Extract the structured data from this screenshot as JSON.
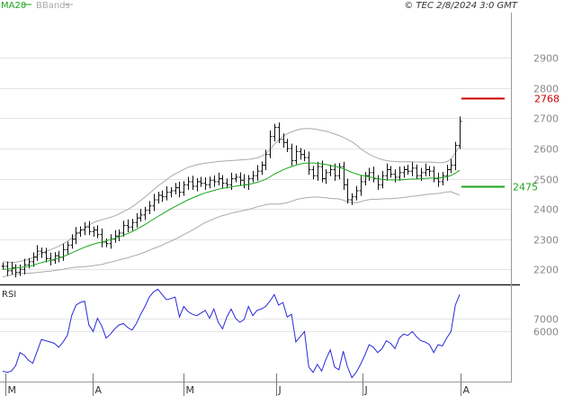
{
  "header": {
    "ma_label": "MA20",
    "bbands_label": "BBands",
    "source_label": "© TEC 2/8/2024 3:0 GMT"
  },
  "colors": {
    "background": "#ffffff",
    "grid": "#e4e4e4",
    "price_bar": "#111111",
    "ma": "#1aa51a",
    "bbands": "#aaaaaa",
    "rsi": "#2a2ad8",
    "resistance": "#cc0000",
    "support": "#1aa51a"
  },
  "chart_data": [
    {
      "type": "ohlc",
      "title": "",
      "y_ticks": [
        2200,
        2300,
        2400,
        2500,
        2600,
        2700,
        2800,
        2900
      ],
      "ylim": [
        2150,
        3050
      ],
      "x_month_labels": [
        "M",
        "A",
        "M",
        "J",
        "J",
        "A"
      ],
      "grid": true,
      "levels": [
        {
          "label": "2768",
          "value": 2768,
          "color": "#cc0000"
        },
        {
          "label": "2475",
          "value": 2475,
          "color": "#1aa51a"
        }
      ],
      "closes": [
        2210,
        2195,
        2205,
        2190,
        2200,
        2215,
        2225,
        2240,
        2260,
        2255,
        2235,
        2230,
        2245,
        2240,
        2265,
        2280,
        2300,
        2320,
        2330,
        2340,
        2325,
        2330,
        2315,
        2290,
        2285,
        2300,
        2310,
        2320,
        2345,
        2340,
        2355,
        2370,
        2380,
        2395,
        2410,
        2430,
        2445,
        2440,
        2455,
        2460,
        2470,
        2455,
        2480,
        2490,
        2475,
        2490,
        2485,
        2480,
        2495,
        2490,
        2500,
        2485,
        2480,
        2500,
        2505,
        2495,
        2480,
        2500,
        2510,
        2525,
        2545,
        2580,
        2640,
        2670,
        2630,
        2620,
        2600,
        2560,
        2590,
        2580,
        2570,
        2530,
        2510,
        2540,
        2500,
        2520,
        2530,
        2510,
        2540,
        2480,
        2430,
        2440,
        2460,
        2490,
        2510,
        2520,
        2500,
        2480,
        2510,
        2530,
        2515,
        2505,
        2520,
        2530,
        2525,
        2535,
        2510,
        2520,
        2530,
        2525,
        2500,
        2490,
        2510,
        2530,
        2545,
        2610,
        2690
      ],
      "ma20": [
        2200,
        2201,
        2202,
        2204,
        2206,
        2208,
        2210,
        2213,
        2218,
        2222,
        2226,
        2229,
        2233,
        2237,
        2242,
        2248,
        2254,
        2261,
        2267,
        2273,
        2278,
        2283,
        2287,
        2290,
        2294,
        2298,
        2302,
        2307,
        2313,
        2318,
        2325,
        2332,
        2340,
        2348,
        2357,
        2366,
        2375,
        2383,
        2392,
        2400,
        2408,
        2415,
        2423,
        2430,
        2436,
        2442,
        2448,
        2453,
        2457,
        2461,
        2465,
        2468,
        2470,
        2473,
        2475,
        2477,
        2479,
        2481,
        2484,
        2488,
        2492,
        2498,
        2506,
        2515,
        2522,
        2529,
        2535,
        2540,
        2545,
        2549,
        2551,
        2552,
        2552,
        2551,
        2549,
        2547,
        2544,
        2541,
        2538,
        2533,
        2527,
        2521,
        2516,
        2512,
        2509,
        2506,
        2503,
        2500,
        2498,
        2497,
        2496,
        2496,
        2496,
        2497,
        2498,
        2499,
        2499,
        2500,
        2501,
        2502,
        2502,
        2502,
        2503,
        2506,
        2511,
        2518,
        2528
      ],
      "bb_upper": [
        2225,
        2224,
        2223,
        2224,
        2226,
        2229,
        2233,
        2238,
        2246,
        2253,
        2259,
        2264,
        2270,
        2276,
        2284,
        2293,
        2303,
        2315,
        2326,
        2337,
        2346,
        2354,
        2360,
        2364,
        2368,
        2372,
        2377,
        2383,
        2391,
        2398,
        2407,
        2417,
        2428,
        2439,
        2451,
        2463,
        2476,
        2486,
        2497,
        2507,
        2516,
        2523,
        2531,
        2538,
        2542,
        2546,
        2549,
        2551,
        2553,
        2555,
        2557,
        2558,
        2559,
        2560,
        2561,
        2562,
        2563,
        2564,
        2566,
        2569,
        2574,
        2582,
        2596,
        2614,
        2628,
        2640,
        2649,
        2655,
        2660,
        2664,
        2666,
        2666,
        2665,
        2663,
        2660,
        2657,
        2653,
        2648,
        2643,
        2637,
        2630,
        2622,
        2612,
        2600,
        2590,
        2581,
        2574,
        2568,
        2563,
        2560,
        2558,
        2557,
        2556,
        2556,
        2556,
        2556,
        2555,
        2555,
        2555,
        2555,
        2554,
        2553,
        2553,
        2556,
        2565,
        2585,
        2610
      ],
      "bb_lower": [
        2175,
        2178,
        2181,
        2184,
        2186,
        2187,
        2187,
        2188,
        2190,
        2191,
        2193,
        2194,
        2196,
        2198,
        2200,
        2203,
        2205,
        2207,
        2208,
        2209,
        2210,
        2212,
        2214,
        2216,
        2220,
        2224,
        2227,
        2231,
        2235,
        2238,
        2243,
        2247,
        2252,
        2257,
        2263,
        2269,
        2274,
        2280,
        2287,
        2293,
        2300,
        2307,
        2315,
        2322,
        2330,
        2338,
        2347,
        2355,
        2361,
        2367,
        2373,
        2378,
        2381,
        2386,
        2389,
        2392,
        2395,
        2398,
        2402,
        2407,
        2410,
        2414,
        2416,
        2416,
        2416,
        2418,
        2421,
        2425,
        2430,
        2434,
        2436,
        2438,
        2439,
        2439,
        2438,
        2437,
        2435,
        2434,
        2433,
        2429,
        2424,
        2420,
        2420,
        2424,
        2428,
        2431,
        2432,
        2432,
        2433,
        2434,
        2434,
        2435,
        2436,
        2438,
        2440,
        2442,
        2443,
        2445,
        2447,
        2449,
        2450,
        2451,
        2453,
        2456,
        2457,
        2451,
        2446
      ]
    },
    {
      "type": "line",
      "title": "RSI",
      "y_ticks": [
        60,
        70
      ],
      "tick_labels": [
        "6000",
        "7000"
      ],
      "ylim": [
        22,
        95
      ],
      "grid": true,
      "values": [
        30,
        29,
        30,
        34,
        44,
        42,
        38,
        36,
        45,
        54,
        53,
        52,
        51,
        48,
        52,
        57,
        72,
        80,
        82,
        83,
        65,
        60,
        70,
        64,
        55,
        58,
        62,
        65,
        66,
        63,
        61,
        66,
        73,
        79,
        86,
        90,
        92,
        88,
        84,
        85,
        86,
        71,
        79,
        75,
        73,
        72,
        74,
        76,
        70,
        77,
        67,
        62,
        71,
        77,
        70,
        67,
        69,
        79,
        72,
        76,
        77,
        79,
        83,
        88,
        80,
        82,
        71,
        73,
        52,
        56,
        60,
        33,
        29,
        35,
        30,
        39,
        46,
        33,
        31,
        45,
        33,
        25,
        29,
        35,
        42,
        50,
        48,
        44,
        47,
        53,
        51,
        47,
        55,
        58,
        57,
        60,
        56,
        53,
        52,
        50,
        44,
        50,
        49,
        55,
        60,
        80,
        88
      ]
    }
  ]
}
